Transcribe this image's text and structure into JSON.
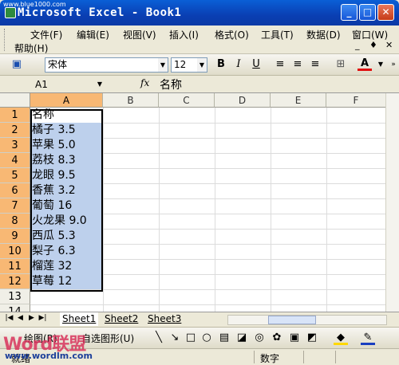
{
  "window": {
    "title": "Microsoft Excel - Book1",
    "watermark_url": "www.blue1000.com",
    "buttons": {
      "minimize": "_",
      "maximize": "□",
      "close": "✕"
    }
  },
  "menubar": {
    "items": [
      "文件(F)",
      "编辑(E)",
      "视图(V)",
      "插入(I)",
      "格式(O)",
      "工具(T)",
      "数据(D)",
      "窗口(W)",
      "帮助(H)"
    ],
    "doc_controls": [
      "_",
      "♦",
      "✕"
    ]
  },
  "toolbar": {
    "font_name": "宋体",
    "font_size": "12",
    "bold": "B",
    "italic": "I",
    "underline": "U",
    "font_color_label": "A"
  },
  "formula_bar": {
    "name_box": "A1",
    "fx_label": "fx",
    "value": "名称"
  },
  "grid": {
    "columns": [
      "A",
      "B",
      "C",
      "D",
      "E",
      "F"
    ],
    "selected_column": "A",
    "rows": [
      "1",
      "2",
      "3",
      "4",
      "5",
      "6",
      "7",
      "8",
      "9",
      "10",
      "11",
      "12",
      "13",
      "14"
    ],
    "cells_A": [
      "名称",
      "橘子 3.5",
      "苹果 5.0",
      "荔枝 8.3",
      "龙眼 9.5",
      "香蕉 3.2",
      "葡萄 16",
      "火龙果 9.0",
      "西瓜 5.3",
      "梨子 6.3",
      "榴莲 32",
      "草莓 12",
      "",
      ""
    ]
  },
  "sheets": {
    "tabs": [
      "Sheet1",
      "Sheet2",
      "Sheet3"
    ],
    "active": "Sheet1",
    "nav": [
      "|◀",
      "◀",
      "▶",
      "▶|"
    ]
  },
  "drawbar": {
    "draw_label": "绘图(R)",
    "autoshapes_label": "自选图形(U)"
  },
  "status": {
    "ready": "就绪",
    "mode": "数字"
  },
  "watermark": {
    "brand": "Word联盟",
    "site": "www.wordlm.com"
  }
}
